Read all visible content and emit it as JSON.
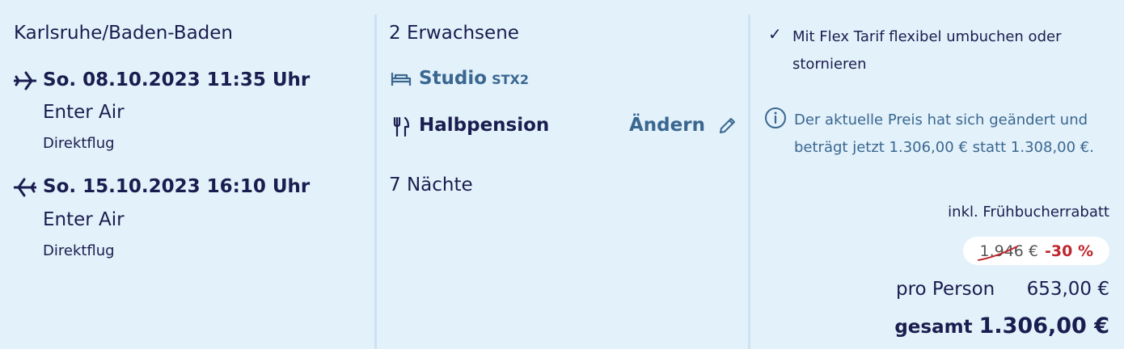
{
  "trip": {
    "origin": "Karlsruhe/Baden-Baden",
    "outbound": {
      "date": "So. 08.10.2023 11:35 Uhr",
      "airline": "Enter Air",
      "type": "Direktflug",
      "icon": "plane-departure-icon"
    },
    "inbound": {
      "date": "So. 15.10.2023 16:10 Uhr",
      "airline": "Enter Air",
      "type": "Direktflug",
      "icon": "plane-arrival-icon"
    }
  },
  "booking": {
    "travellers": "2 Erwachsene",
    "room": {
      "name": "Studio",
      "code": "STX2",
      "icon": "bed-icon"
    },
    "meal": {
      "name": "Halbpension",
      "icon": "cutlery-icon"
    },
    "change_label": "Ändern",
    "nights": "7 Nächte"
  },
  "pricing": {
    "flex_text": "Mit Flex Tarif flexibel umbuchen oder stornieren",
    "price_change_note": "Der aktuelle Preis hat sich geändert und beträgt jetzt 1.306,00 € statt 1.308,00 €.",
    "early_booking": "inkl. Frühbucherrabatt",
    "old_price": "1.946 €",
    "discount": "-30 %",
    "per_person_label": "pro Person",
    "per_person_value": "653,00 €",
    "total_label": "gesamt",
    "total_value": "1.306,00 €",
    "colors": {
      "text": "#1a1d4f",
      "link": "#3a6790",
      "discount": "#c0262d",
      "background": "#e3f1fa"
    }
  }
}
